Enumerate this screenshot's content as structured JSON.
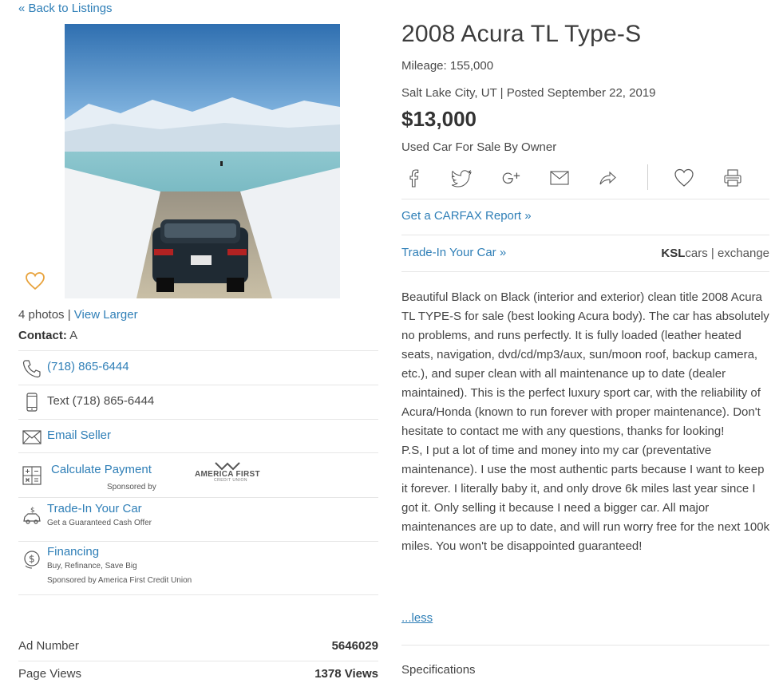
{
  "nav": {
    "back_label": "« Back to Listings"
  },
  "listing": {
    "title": "2008 Acura TL Type-S",
    "mileage": "Mileage: 155,000",
    "location_posted": "Salt Lake City, UT | Posted September 22, 2019",
    "price": "$13,000",
    "seller_type": "Used Car For Sale By Owner"
  },
  "photos": {
    "count_text": "4 photos |",
    "view_larger": "View Larger"
  },
  "contact": {
    "label": "Contact:",
    "name": "A",
    "phone": "(718) 865-6444",
    "text": "Text (718) 865-6444",
    "email": "Email Seller",
    "calc": "Calculate Payment",
    "sponsored_by": "Sponsored by",
    "tradein": "Trade-In Your Car",
    "tradein_sub": "Get a Guaranteed Cash Offer",
    "financing": "Financing",
    "financing_sub1": "Buy, Refinance, Save Big",
    "financing_sub2": "Sponsored by America First Credit Union",
    "afcu_logo_text": "AMERICA FIRST",
    "afcu_logo_sub": "CREDIT UNION"
  },
  "stats": {
    "ad_number_label": "Ad Number",
    "ad_number": "5646029",
    "page_views_label": "Page Views",
    "page_views": "1378 Views"
  },
  "share_icons": [
    "facebook-icon",
    "twitter-icon",
    "google-plus-icon",
    "mail-icon",
    "share-icon",
    "heart-icon",
    "print-icon"
  ],
  "links": {
    "carfax": "Get a CARFAX Report »",
    "tradein": "Trade-In Your Car »",
    "ksl_brand_bold": "KSL",
    "ksl_brand_rest": "cars | exchange"
  },
  "description": {
    "p1": "Beautiful Black on Black (interior and exterior) clean title 2008 Acura TL TYPE-S for sale (best looking Acura body). The car has absolutely no problems, and runs perfectly. It is fully loaded (leather heated seats, navigation, dvd/cd/mp3/aux, sun/moon roof, backup camera, etc.), and super clean with all maintenance up to date (dealer maintained). This is the perfect luxury sport car, with the reliability of Acura/Honda (known to run forever with proper maintenance). Don't hesitate to contact me with any questions, thanks for looking!",
    "p2": "P.S, I put a lot of time and money into my car (preventative maintenance). I use the most authentic parts because I want to keep it forever. I literally baby it, and only drove 6k miles last year since I got it. Only selling it because I need a bigger car. All major maintenances are up to date, and will run worry free for the next 100k miles. You won't be disappointed guaranteed!",
    "less": "...less"
  },
  "specs": {
    "heading": "Specifications"
  },
  "colors": {
    "link": "#2f7fb7",
    "heart": "#e8a33d",
    "text": "#4a4a4a"
  }
}
